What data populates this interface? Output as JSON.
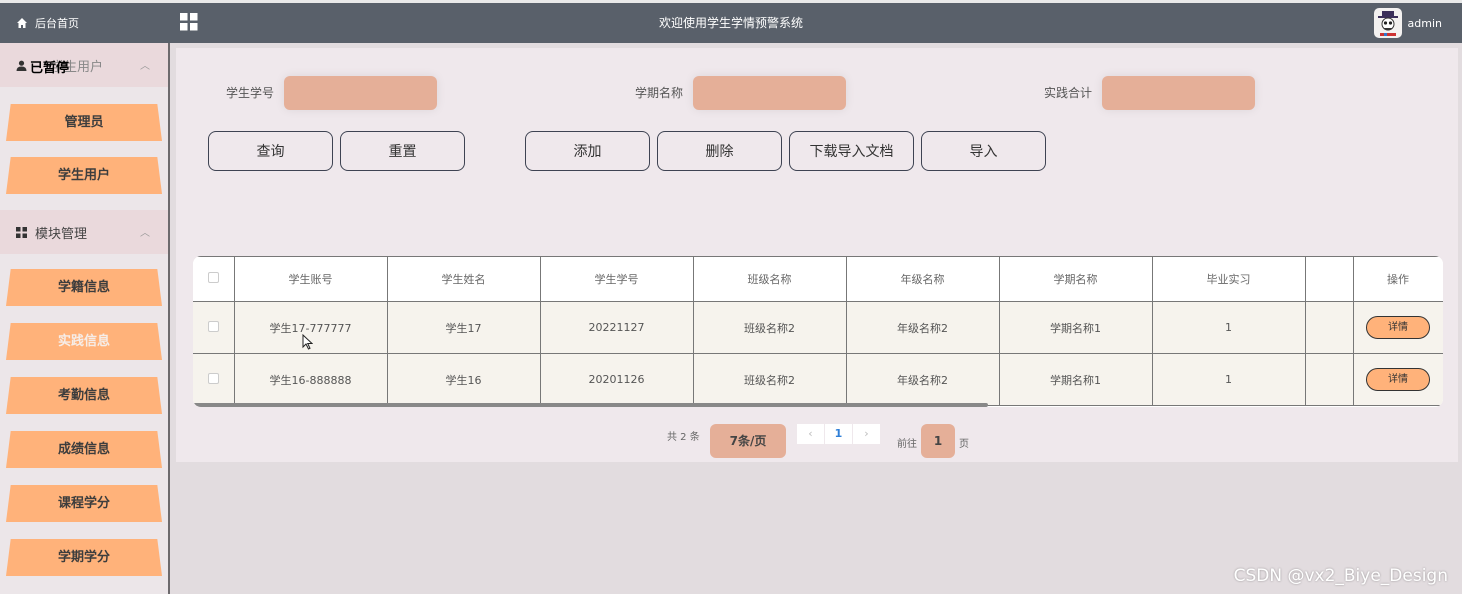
{
  "topbar": {
    "home_label": "后台首页",
    "title": "欢迎使用学生学情预警系统",
    "username": "admin"
  },
  "sidebar": {
    "group1": {
      "label": "学生用户",
      "overlap_label": "已暂停",
      "items": [
        "管理员",
        "学生用户"
      ]
    },
    "group2": {
      "label": "模块管理",
      "items": [
        "学籍信息",
        "实践信息",
        "考勤信息",
        "成绩信息",
        "课程学分",
        "学期学分"
      ]
    }
  },
  "search": {
    "fields": [
      {
        "label": "学生学号",
        "value": ""
      },
      {
        "label": "学期名称",
        "value": ""
      },
      {
        "label": "实践合计",
        "value": ""
      }
    ]
  },
  "toolbar": {
    "query": "查询",
    "reset": "重置",
    "add": "添加",
    "delete": "删除",
    "download": "下载导入文档",
    "import": "导入"
  },
  "table": {
    "columns": [
      "学生账号",
      "学生姓名",
      "学生学号",
      "班级名称",
      "年级名称",
      "学期名称",
      "毕业实习",
      "",
      "操作"
    ],
    "rows": [
      {
        "account": "学生17-777777",
        "name": "学生17",
        "number": "20221127",
        "class": "班级名称2",
        "grade": "年级名称2",
        "term": "学期名称1",
        "internship": "1",
        "extra": "",
        "action": "详情"
      },
      {
        "account": "学生16-888888",
        "name": "学生16",
        "number": "20201126",
        "class": "班级名称2",
        "grade": "年级名称2",
        "term": "学期名称1",
        "internship": "1",
        "extra": "",
        "action": "详情"
      }
    ]
  },
  "pagination": {
    "total_text": "共 2 条",
    "page_size": "7条/页",
    "prev": "‹",
    "current": "1",
    "next": "›",
    "goto_label": "前往",
    "goto_value": "1",
    "page_suffix": "页"
  },
  "watermark": "CSDN @vx2_Biye_Design",
  "colors": {
    "topbar": "#59606a",
    "accent": "#ffb27a",
    "input_fill": "#e5af98",
    "page_bg": "#efe8ec"
  }
}
